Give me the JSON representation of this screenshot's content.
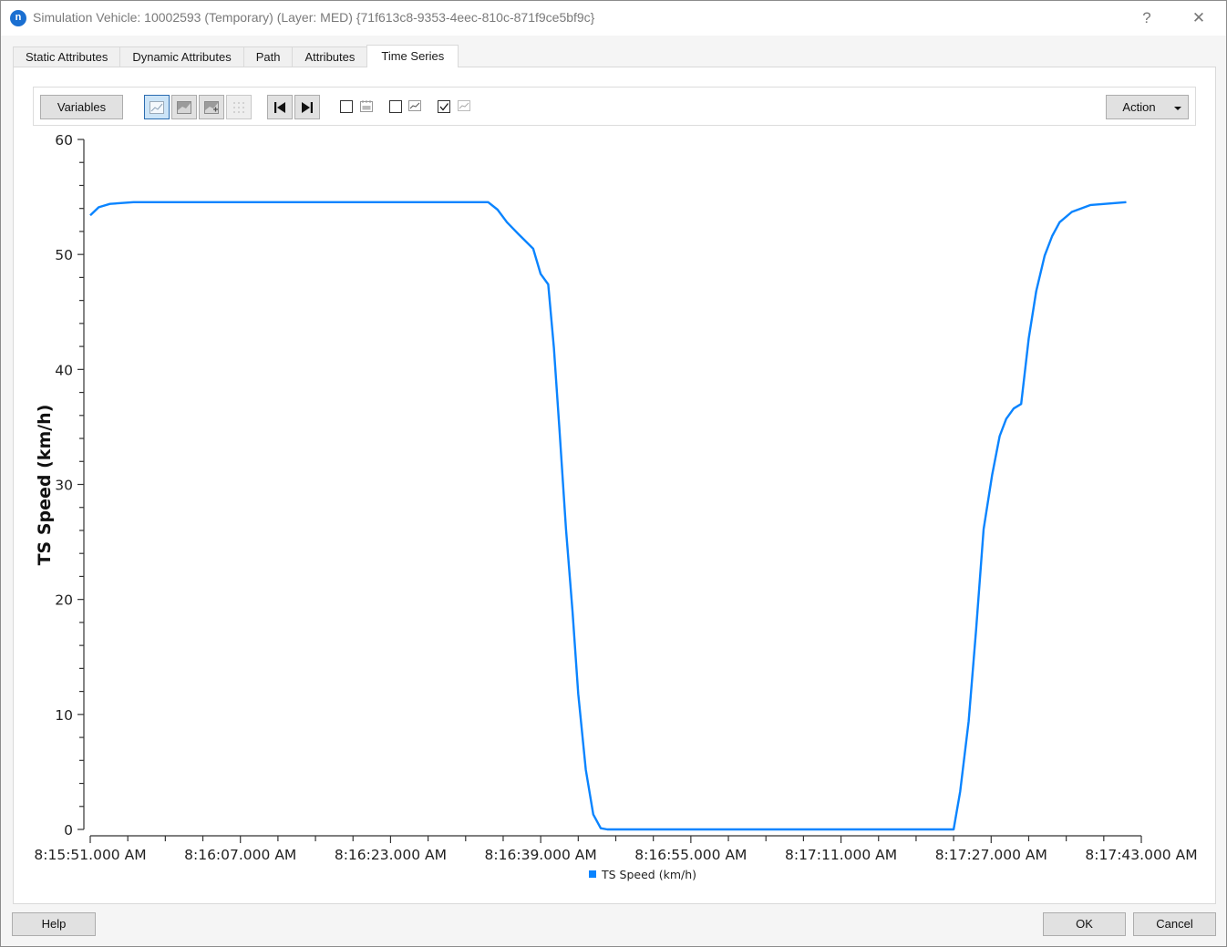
{
  "window": {
    "title": "Simulation Vehicle: 10002593 (Temporary) (Layer: MED) {71f613c8-9353-4eec-810c-871f9ce5bf9c}",
    "app_icon_letter": "n",
    "help_glyph": "?",
    "close_glyph": "✕"
  },
  "tabs": [
    {
      "label": "Static Attributes",
      "active": false
    },
    {
      "label": "Dynamic Attributes",
      "active": false
    },
    {
      "label": "Path",
      "active": false
    },
    {
      "label": "Attributes",
      "active": false
    },
    {
      "label": "Time Series",
      "active": true
    }
  ],
  "toolbar": {
    "variables_label": "Variables",
    "action_label": "Action",
    "tools": [
      {
        "icon": "line-chart-icon",
        "active": true
      },
      {
        "icon": "area-chart-icon",
        "active": false
      },
      {
        "icon": "add-chart-icon",
        "active": false
      },
      {
        "icon": "grid-dots-icon",
        "active": false,
        "disabled": true
      },
      {
        "icon": "skip-to-start-icon",
        "active": false
      },
      {
        "icon": "skip-to-end-icon",
        "active": false
      }
    ],
    "checkboxes": [
      {
        "icon": "calendar-icon",
        "checked": false
      },
      {
        "icon": "trend-line-icon",
        "checked": false
      },
      {
        "icon": "trend-line-light-icon",
        "checked": true
      }
    ]
  },
  "footer": {
    "help_label": "Help",
    "ok_label": "OK",
    "cancel_label": "Cancel"
  },
  "chart_data": {
    "type": "line",
    "title": "",
    "xlabel": "",
    "ylabel": "TS Speed (km/h)",
    "ylim": [
      0,
      60
    ],
    "yticks": [
      0,
      10,
      20,
      30,
      40,
      50,
      60
    ],
    "y_minor_step": 2,
    "x_start_time": "8:15:51.000 AM",
    "x_unit": "seconds since 8:15:51.000 AM",
    "xlim": [
      0,
      112
    ],
    "x_minor_step": 4,
    "xticks": [
      {
        "t": 0,
        "label": "8:15:51.000 AM"
      },
      {
        "t": 16,
        "label": "8:16:07.000 AM"
      },
      {
        "t": 32,
        "label": "8:16:23.000 AM"
      },
      {
        "t": 48,
        "label": "8:16:39.000 AM"
      },
      {
        "t": 64,
        "label": "8:16:55.000 AM"
      },
      {
        "t": 80,
        "label": "8:17:11.000 AM"
      },
      {
        "t": 96,
        "label": "8:17:27.000 AM"
      },
      {
        "t": 112,
        "label": "8:17:43.000 AM"
      }
    ],
    "legend": {
      "position": "bottom-center",
      "entries": [
        "TS Speed (km/h)"
      ]
    },
    "grid": false,
    "series": [
      {
        "name": "TS Speed (km/h)",
        "color": "#0a84ff",
        "x": [
          0,
          0.9,
          2.1,
          4.6,
          10,
          20,
          30,
          42.4,
          43.4,
          44.4,
          45.6,
          47.2,
          48.0,
          48.8,
          49.4,
          50.0,
          50.7,
          51.4,
          52.0,
          52.8,
          53.6,
          54.4,
          55.1,
          60,
          70,
          80,
          92.0,
          92.7,
          93.6,
          94.4,
          95.2,
          96.1,
          96.9,
          97.6,
          98.4,
          99.2,
          100.0,
          100.8,
          101.7,
          102.5,
          103.3,
          104.6,
          106.6,
          110.4
        ],
        "values": [
          53.4,
          54.1,
          54.4,
          54.55,
          54.55,
          54.55,
          54.55,
          54.55,
          53.9,
          52.8,
          51.8,
          50.5,
          48.3,
          47.4,
          41.9,
          34.8,
          26.1,
          18.9,
          11.8,
          5.2,
          1.3,
          0.1,
          0,
          0,
          0,
          0,
          0,
          3.3,
          9.4,
          17.4,
          26.1,
          30.8,
          34.2,
          35.7,
          36.6,
          37.0,
          42.7,
          46.8,
          49.9,
          51.6,
          52.8,
          53.7,
          54.3,
          54.55
        ]
      }
    ]
  }
}
